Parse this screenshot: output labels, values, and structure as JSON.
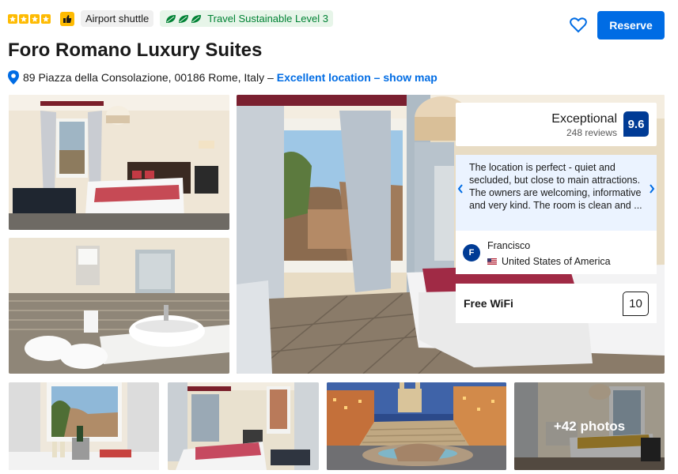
{
  "badges": {
    "star_count": 4,
    "airport_shuttle": "Airport shuttle",
    "sustainable": "Travel Sustainable Level 3"
  },
  "actions": {
    "reserve_label": "Reserve"
  },
  "hotel": {
    "name": "Foro Romano Luxury Suites",
    "address": "89 Piazza della Consolazione, 00186 Rome, Italy –",
    "location_link": "Excellent location – show map"
  },
  "review": {
    "rating_label": "Exceptional",
    "review_count": "248 reviews",
    "score": "9.6",
    "quote": "The location is perfect - quiet and secluded, but close to main attractions. The owners are welcoming, informative and very kind. The room is clean and ...",
    "reviewer_initial": "F",
    "reviewer_name": "Francisco",
    "reviewer_country": "United States of America"
  },
  "facility": {
    "label": "Free WiFi",
    "score": "10"
  },
  "gallery": {
    "more_photos": "+42 photos"
  },
  "colors": {
    "brand_blue": "#006ce4",
    "dark_blue": "#003b95",
    "star_yellow": "#febb02",
    "green": "#008234"
  }
}
